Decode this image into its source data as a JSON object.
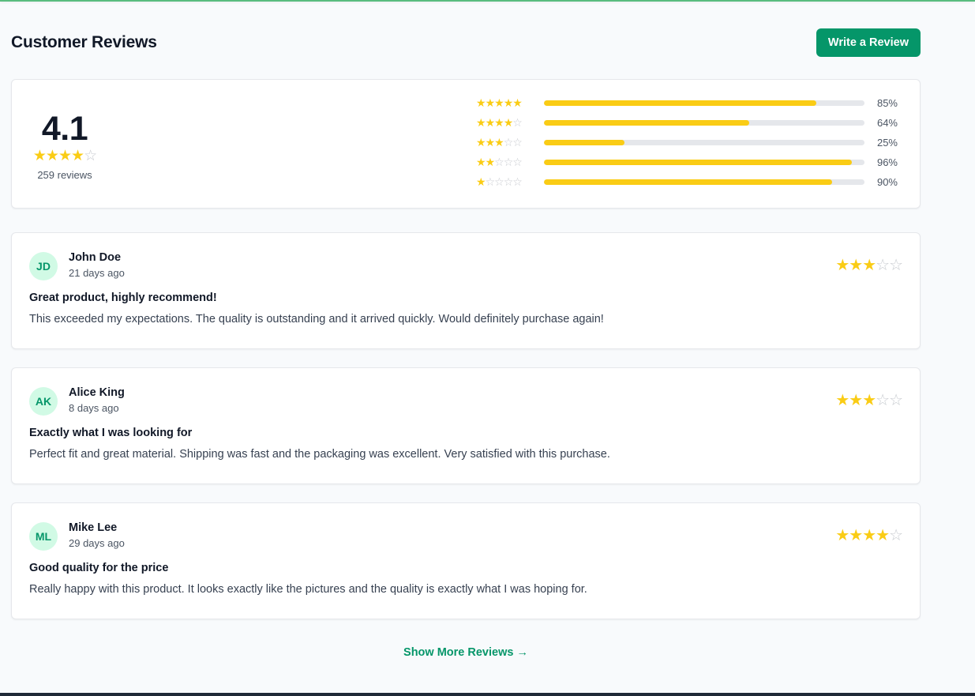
{
  "header": {
    "title": "Customer Reviews",
    "write_label": "Write a Review"
  },
  "colors": {
    "accent": "#059669",
    "star": "#facc15",
    "avatar_bg": "#d1fae5"
  },
  "summary": {
    "average": "4.1",
    "average_stars": 4,
    "count_label": "259 reviews",
    "distribution": [
      {
        "stars": 5,
        "percent": 85,
        "label": "85%"
      },
      {
        "stars": 4,
        "percent": 64,
        "label": "64%"
      },
      {
        "stars": 3,
        "percent": 25,
        "label": "25%"
      },
      {
        "stars": 2,
        "percent": 96,
        "label": "96%"
      },
      {
        "stars": 1,
        "percent": 90,
        "label": "90%"
      }
    ]
  },
  "reviews": [
    {
      "initials": "JD",
      "name": "John Doe",
      "date": "21 days ago",
      "rating": 3,
      "title": "Great product, highly recommend!",
      "body": "This exceeded my expectations. The quality is outstanding and it arrived quickly. Would definitely purchase again!"
    },
    {
      "initials": "AK",
      "name": "Alice King",
      "date": "8 days ago",
      "rating": 3,
      "title": "Exactly what I was looking for",
      "body": "Perfect fit and great material. Shipping was fast and the packaging was excellent. Very satisfied with this purchase."
    },
    {
      "initials": "ML",
      "name": "Mike Lee",
      "date": "29 days ago",
      "rating": 4,
      "title": "Good quality for the price",
      "body": "Really happy with this product. It looks exactly like the pictures and the quality is exactly what I was hoping for."
    }
  ],
  "footer": {
    "more_label": "Show More Reviews →"
  }
}
